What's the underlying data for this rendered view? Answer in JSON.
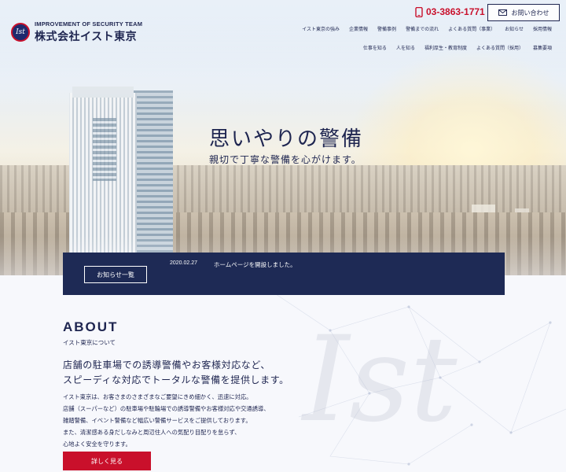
{
  "brand": {
    "logo_mark": "Ist",
    "tagline": "IMPROVEMENT OF SECURITY TEAM",
    "name": "株式会社イスト東京"
  },
  "header": {
    "phone": "03-3863-1771",
    "contact_label": "お問い合わせ",
    "nav_primary": [
      "イスト東京の強み",
      "企業情報",
      "警備事例",
      "警備までの流れ",
      "よくある質問（事業）",
      "お知らせ",
      "採用情報"
    ],
    "nav_secondary": [
      "仕事を知る",
      "人を知る",
      "福利厚生・教育制度",
      "よくある質問（採用）",
      "募集要項"
    ]
  },
  "hero": {
    "title": "思いやりの警備",
    "subtitle": "親切で丁寧な警備を心がけます。"
  },
  "news": {
    "list_button": "お知らせ一覧",
    "items": [
      {
        "date": "2020.02.27",
        "text": "ホームページを開設しました。"
      }
    ]
  },
  "about": {
    "title": "ABOUT",
    "subtitle": "イスト東京について",
    "lead": [
      "店舗の駐車場での誘導警備やお客様対応など、",
      "スピーディな対応でトータルな警備を提供します。"
    ],
    "body": [
      "イスト東京は、お客さまのさまざまなご要望にきめ細かく、迅速に対応。",
      "店舗（スーパーなど）の駐車場や駐輪場での誘導警備やお客様対応や交通誘導、",
      "雑踏警備、イベント警備など幅広い警備サービスをご提供しております。",
      "また、清潔感ある身だしなみと周辺住人への気配り目配りを怠らず、",
      "心地よく安全を守ります。"
    ],
    "more_button": "詳しく見る",
    "watermark": "Ist"
  },
  "colors": {
    "navy": "#1e2a55",
    "accent_red": "#c9102b",
    "text": "#1e2550"
  }
}
